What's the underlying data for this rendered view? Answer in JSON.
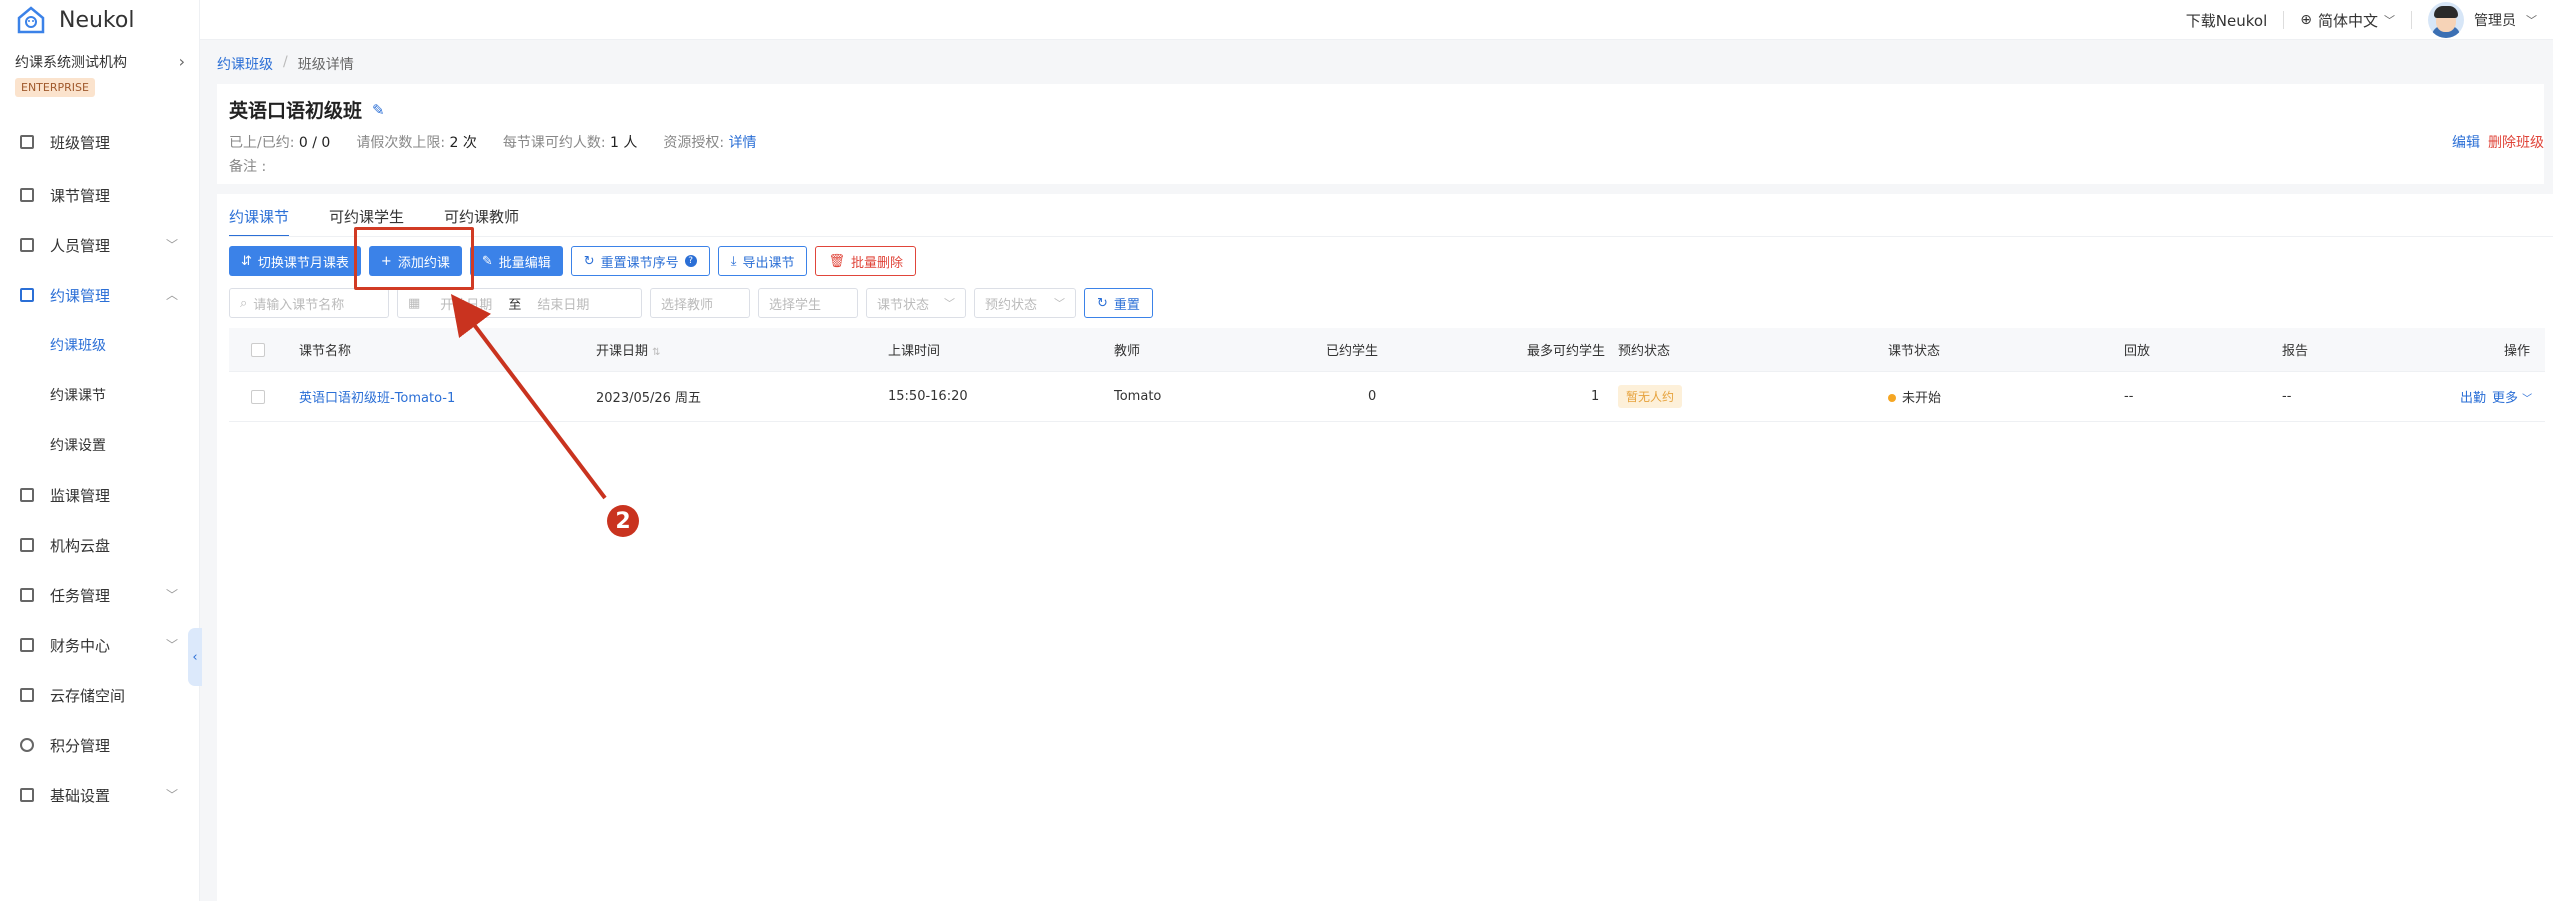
{
  "brand": {
    "name": "Neukol"
  },
  "sidebar": {
    "org_name": "约课系统测试机构",
    "edition": "ENTERPRISE",
    "items": [
      {
        "label": "班级管理",
        "icon": "class-icon"
      },
      {
        "label": "课节管理",
        "icon": "lesson-icon"
      },
      {
        "label": "人员管理",
        "icon": "people-icon"
      },
      {
        "label": "约课管理",
        "icon": "booking-icon"
      },
      {
        "label": "约课班级"
      },
      {
        "label": "约课课节"
      },
      {
        "label": "约课设置"
      },
      {
        "label": "监课管理",
        "icon": "monitor-icon"
      },
      {
        "label": "机构云盘",
        "icon": "cloud-icon"
      },
      {
        "label": "任务管理",
        "icon": "task-icon"
      },
      {
        "label": "财务中心",
        "icon": "finance-icon"
      },
      {
        "label": "云存储空间",
        "icon": "storage-icon"
      },
      {
        "label": "积分管理",
        "icon": "points-icon"
      },
      {
        "label": "基础设置",
        "icon": "settings-icon"
      }
    ]
  },
  "topbar": {
    "download": "下载Neukol",
    "language": "简体中文",
    "user": "管理员"
  },
  "breadcrumb": {
    "parent": "约课班级",
    "current": "班级详情"
  },
  "class_info": {
    "title": "英语口语初级班",
    "attended_label": "已上/已约:",
    "attended_value": "0 / 0",
    "leave_label": "请假次数上限:",
    "leave_value": "2 次",
    "per_lesson_label": "每节课可约人数:",
    "per_lesson_value": "1 人",
    "resource_label": "资源授权:",
    "resource_link": "详情",
    "note_label": "备注 :",
    "edit": "编辑",
    "delete": "删除班级"
  },
  "tabs": [
    "约课课节",
    "可约课学生",
    "可约课教师"
  ],
  "toolbar": {
    "switch": "切换课节月课表",
    "add": "添加约课",
    "bulk_edit": "批量编辑",
    "reset_order": "重置课节序号",
    "export": "导出课节",
    "bulk_delete": "批量删除"
  },
  "filters": {
    "lesson_name_placeholder": "请输入课节名称",
    "start_date_placeholder": "开始日期",
    "to": "至",
    "end_date_placeholder": "结束日期",
    "teacher_placeholder": "选择教师",
    "student_placeholder": "选择学生",
    "lesson_status_placeholder": "课节状态",
    "booking_status_placeholder": "预约状态",
    "reset": "重置"
  },
  "table": {
    "columns": [
      "课节名称",
      "开课日期",
      "上课时间",
      "教师",
      "已约学生",
      "最多可约学生",
      "预约状态",
      "课节状态",
      "回放",
      "报告",
      "操作"
    ],
    "rows": [
      {
        "name": "英语口语初级班-Tomato-1",
        "date": "2023/05/26 周五",
        "time": "15:50-16:20",
        "teacher": "Tomato",
        "booked": "0",
        "max": "1",
        "booking_status": "暂无人约",
        "lesson_status": "未开始",
        "replay": "--",
        "report": "--",
        "action_1": "出勤",
        "action_2": "更多"
      }
    ]
  },
  "annotation": {
    "step": "2"
  },
  "colors": {
    "primary": "#3b82e8",
    "danger": "#e0453a",
    "annotation": "#d13b24"
  }
}
